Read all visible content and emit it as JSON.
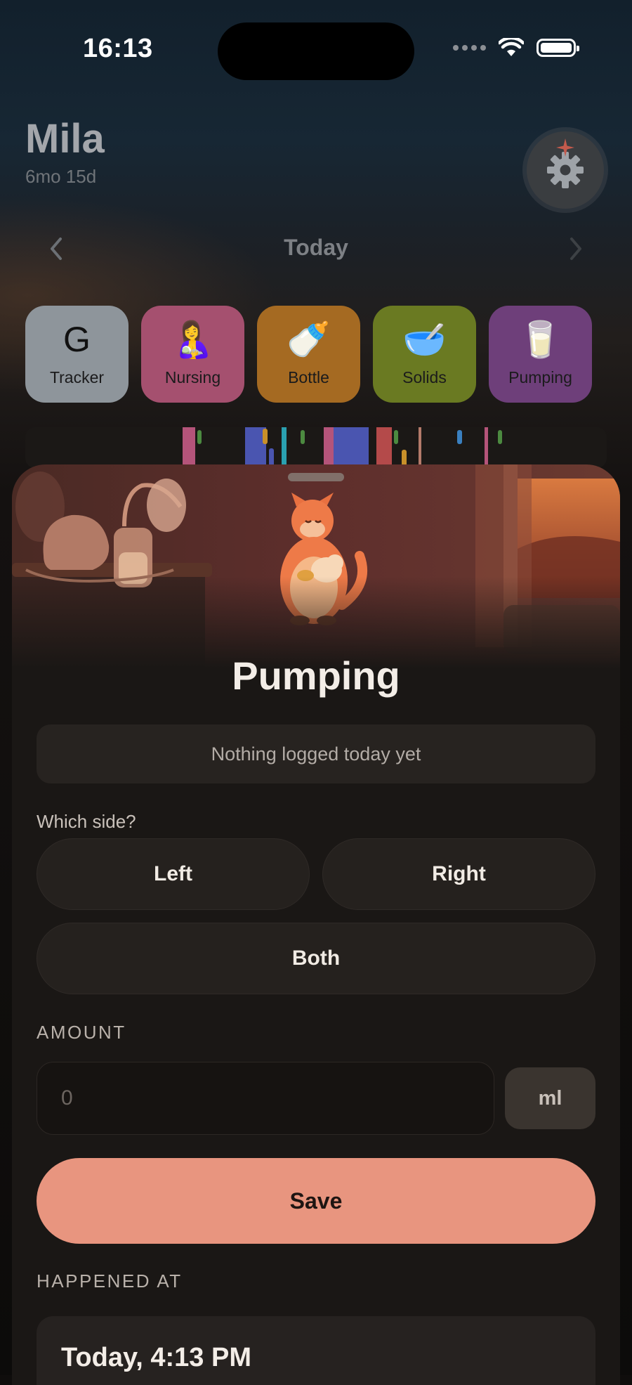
{
  "status_bar": {
    "time": "16:13"
  },
  "profile": {
    "name": "Mila",
    "age": "6mo 15d"
  },
  "day_nav": {
    "title": "Today"
  },
  "categories": [
    {
      "label": "Tracker",
      "glyph": "G",
      "color": "#8e959b"
    },
    {
      "label": "Nursing",
      "glyph": "🤱",
      "color": "#a5506f"
    },
    {
      "label": "Bottle",
      "glyph": "🍼",
      "color": "#a56a22"
    },
    {
      "label": "Solids",
      "glyph": "🥣",
      "color": "#6a7a22"
    },
    {
      "label": "Pumping",
      "glyph": "🥛",
      "color": "#6e3f7a"
    }
  ],
  "sheet": {
    "title": "Pumping",
    "empty_message": "Nothing logged today yet",
    "side_question": "Which side?",
    "sides": {
      "left": "Left",
      "right": "Right",
      "both": "Both"
    },
    "amount_label": "AMOUNT",
    "amount_placeholder": "0",
    "amount_unit": "ml",
    "save_label": "Save",
    "happened_label": "HAPPENED AT",
    "happened_value": "Today, 4:13 PM"
  },
  "colors": {
    "accent": "#e8957f",
    "sheet_bg": "#1a1715",
    "card_bg": "#25211e"
  },
  "icons": [
    "wifi-icon",
    "battery-icon",
    "gear-icon",
    "chevron-left-icon",
    "chevron-right-icon",
    "kangaroo-illustration",
    "breast-pump-illustration"
  ]
}
